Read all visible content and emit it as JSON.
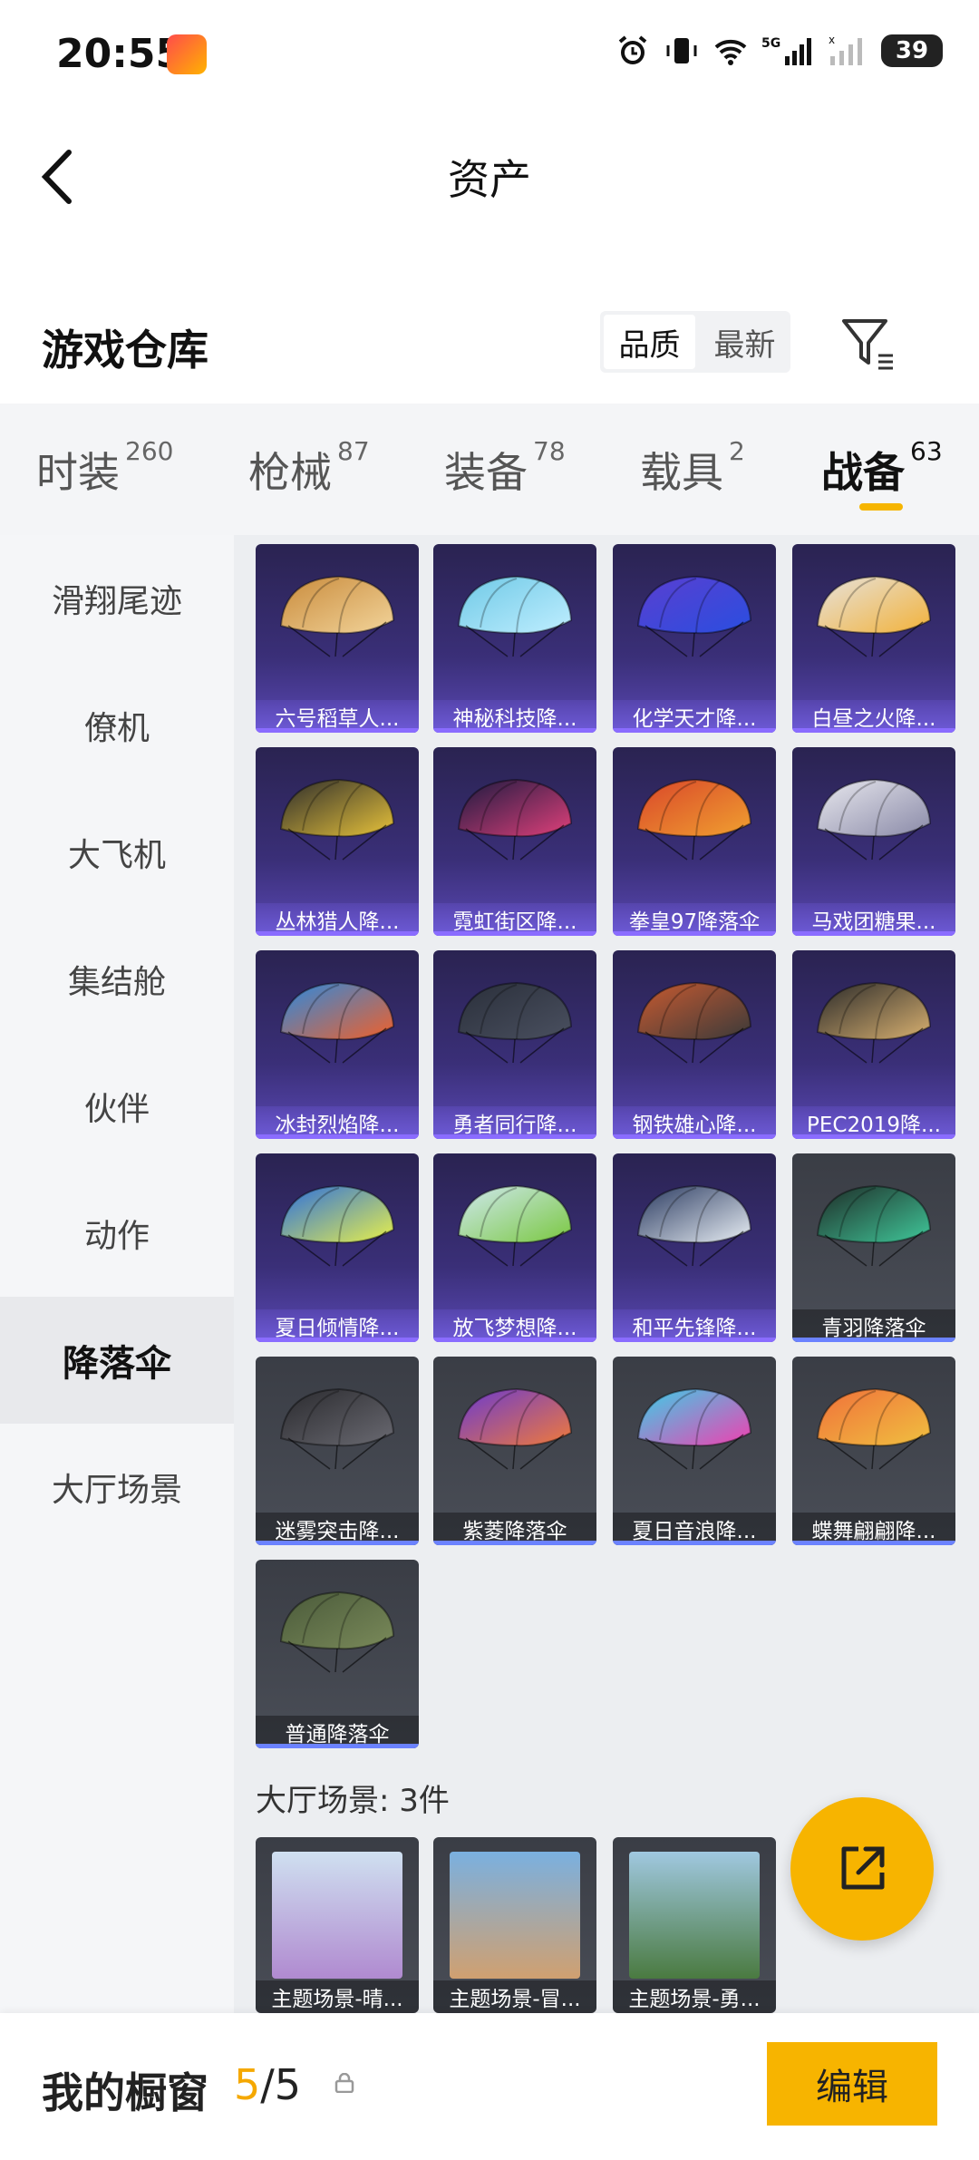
{
  "status_bar": {
    "time": "20:55",
    "battery": "39"
  },
  "header": {
    "title": "资产"
  },
  "section": {
    "title": "游戏仓库",
    "sort_options": [
      "品质",
      "最新"
    ],
    "sort_active": "品质"
  },
  "tabs": [
    {
      "label": "时装",
      "count": "260"
    },
    {
      "label": "枪械",
      "count": "87"
    },
    {
      "label": "装备",
      "count": "78"
    },
    {
      "label": "载具",
      "count": "2"
    },
    {
      "label": "战备",
      "count": "63",
      "active": true
    }
  ],
  "sidebar": {
    "items": [
      "滑翔尾迹",
      "僚机",
      "大飞机",
      "集结舱",
      "伙伴",
      "动作",
      "降落伞",
      "大厅场景"
    ],
    "active": "降落伞"
  },
  "parachutes": [
    {
      "name": "六号稻草人...",
      "rarity": "purple",
      "colors": [
        "#c98b3c",
        "#f2d49a"
      ]
    },
    {
      "name": "神秘科技降...",
      "rarity": "purple",
      "colors": [
        "#6fc9e6",
        "#bfeeff"
      ]
    },
    {
      "name": "化学天才降...",
      "rarity": "purple",
      "colors": [
        "#5a3fd0",
        "#2a4ee0"
      ]
    },
    {
      "name": "白昼之火降...",
      "rarity": "purple",
      "colors": [
        "#e6e2dc",
        "#f2b23a"
      ]
    },
    {
      "name": "丛林猎人降...",
      "rarity": "purple",
      "colors": [
        "#2c2c2c",
        "#e7c23a"
      ]
    },
    {
      "name": "霓虹街区降...",
      "rarity": "purple",
      "colors": [
        "#1a1a40",
        "#e0407a"
      ]
    },
    {
      "name": "拳皇97降落伞",
      "rarity": "purple",
      "colors": [
        "#d9462a",
        "#f0a030"
      ]
    },
    {
      "name": "马戏团糖果...",
      "rarity": "purple",
      "colors": [
        "#e8e8ee",
        "#8a8aa8"
      ]
    },
    {
      "name": "冰封烈焰降...",
      "rarity": "purple",
      "colors": [
        "#2a8ae0",
        "#f0602a"
      ]
    },
    {
      "name": "勇者同行降...",
      "rarity": "purple",
      "colors": [
        "#2a2f3a",
        "#4a5060"
      ]
    },
    {
      "name": "钢铁雄心降...",
      "rarity": "purple",
      "colors": [
        "#c85a30",
        "#3a3a3a"
      ]
    },
    {
      "name": "PEC2019降...",
      "rarity": "purple",
      "colors": [
        "#2a2a2a",
        "#d8b070"
      ]
    },
    {
      "name": "夏日倾情降...",
      "rarity": "purple",
      "colors": [
        "#2a6ee0",
        "#e8f04a"
      ]
    },
    {
      "name": "放飞梦想降...",
      "rarity": "purple",
      "colors": [
        "#cfe8f0",
        "#7ac840"
      ]
    },
    {
      "name": "和平先锋降...",
      "rarity": "purple",
      "colors": [
        "#2a3a60",
        "#e8eef4"
      ]
    },
    {
      "name": "青羽降落伞",
      "rarity": "gray",
      "colors": [
        "#1e2a26",
        "#40c89a"
      ]
    },
    {
      "name": "迷雾突击降...",
      "rarity": "gray",
      "colors": [
        "#2a2a2e",
        "#6a6a72"
      ]
    },
    {
      "name": "紫菱降落伞",
      "rarity": "gray",
      "colors": [
        "#6a3ad0",
        "#f07a3a"
      ]
    },
    {
      "name": "夏日音浪降...",
      "rarity": "gray",
      "colors": [
        "#3ad0e8",
        "#f040b0"
      ]
    },
    {
      "name": "蝶舞翩翩降...",
      "rarity": "gray",
      "colors": [
        "#f0703a",
        "#f0c040"
      ]
    },
    {
      "name": "普通降落伞",
      "rarity": "gray",
      "colors": [
        "#4a5a3a",
        "#7a8a5a"
      ]
    }
  ],
  "scene_group": {
    "title": "大厅场景: 3件"
  },
  "scenes": [
    {
      "name": "主题场景-晴...",
      "colors": [
        "#cfe0f0",
        "#b08ad0"
      ]
    },
    {
      "name": "主题场景-冒...",
      "colors": [
        "#7ab0e0",
        "#d0a070"
      ]
    },
    {
      "name": "主题场景-勇...",
      "colors": [
        "#a0c8e0",
        "#4a7a40"
      ]
    }
  ],
  "bottom_bar": {
    "label": "我的橱窗",
    "current": "5",
    "total": "/5",
    "edit_label": "编辑"
  }
}
